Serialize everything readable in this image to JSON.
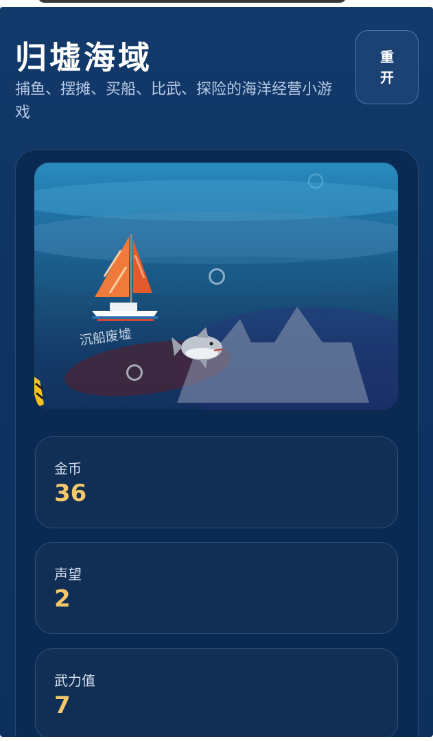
{
  "header": {
    "title": "归墟海域",
    "subtitle": "捕鱼、摆摊、买船、比武、探险的海洋经营小游戏",
    "restart_label": "重开"
  },
  "scene": {
    "location_label": "沉船废墟",
    "boat_emoji": "⛵",
    "shark_emoji": "🦈"
  },
  "stats": [
    {
      "label": "金币",
      "value": "36"
    },
    {
      "label": "声望",
      "value": "2"
    },
    {
      "label": "武力值",
      "value": "7"
    }
  ],
  "colors": {
    "background": "#0f3563",
    "accent_value": "#f2c86a",
    "card_border": "#2e527f"
  }
}
